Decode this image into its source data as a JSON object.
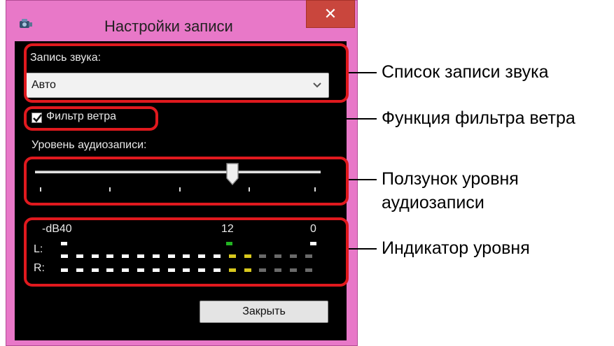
{
  "window": {
    "title": "Настройки записи",
    "close_glyph": "✕"
  },
  "audio_recording": {
    "label": "Запись звука:",
    "selected": "Авто"
  },
  "wind_filter": {
    "label": "Фильтр ветра",
    "checked": true
  },
  "recording_level": {
    "label": "Уровень аудиозаписи:",
    "slider_value_fraction": 0.7,
    "tick_count": 5
  },
  "level_meter": {
    "scale_labels": [
      "-dB40",
      "12",
      "0"
    ],
    "channels": [
      "L:",
      "R:"
    ],
    "segment_count": 17,
    "lit_segments": 13
  },
  "close_button": "Закрыть",
  "callouts": {
    "audio_list": "Список записи звука",
    "wind_filter": "Функция фильтра ветра",
    "level_slider": [
      "Ползунок уровня",
      "аудиозаписи"
    ],
    "meter": "Индикатор уровня"
  },
  "colors": {
    "frame": "#e878c8",
    "highlight": "#e0191e",
    "meter_white": "#ffffff",
    "meter_yellow": "#d8c81e",
    "meter_grey": "#6a6a6a",
    "peak_green": "#22b422"
  }
}
